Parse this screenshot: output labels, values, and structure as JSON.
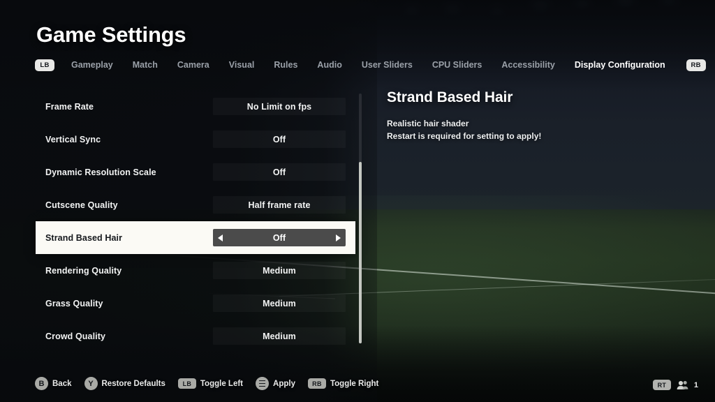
{
  "header": {
    "title": "Game Settings",
    "left_bumper": "LB",
    "right_bumper": "RB",
    "tabs": [
      {
        "label": "Gameplay",
        "active": false
      },
      {
        "label": "Match",
        "active": false
      },
      {
        "label": "Camera",
        "active": false
      },
      {
        "label": "Visual",
        "active": false
      },
      {
        "label": "Rules",
        "active": false
      },
      {
        "label": "Audio",
        "active": false
      },
      {
        "label": "User Sliders",
        "active": false
      },
      {
        "label": "CPU Sliders",
        "active": false
      },
      {
        "label": "Accessibility",
        "active": false
      },
      {
        "label": "Display Configuration",
        "active": true
      }
    ]
  },
  "settings": {
    "rows": [
      {
        "label": "Frame Rate",
        "value": "No Limit on fps",
        "selected": false
      },
      {
        "label": "Vertical Sync",
        "value": "Off",
        "selected": false
      },
      {
        "label": "Dynamic Resolution Scale",
        "value": "Off",
        "selected": false
      },
      {
        "label": "Cutscene Quality",
        "value": "Half frame rate",
        "selected": false
      },
      {
        "label": "Strand Based Hair",
        "value": "Off",
        "selected": true
      },
      {
        "label": "Rendering Quality",
        "value": "Medium",
        "selected": false
      },
      {
        "label": "Grass Quality",
        "value": "Medium",
        "selected": false
      },
      {
        "label": "Crowd Quality",
        "value": "Medium",
        "selected": false
      }
    ]
  },
  "detail": {
    "title": "Strand Based Hair",
    "line1": "Realistic hair shader",
    "line2": "Restart is required for setting to apply!"
  },
  "hints": [
    {
      "glyph": "B",
      "glyph_type": "circle",
      "label": "Back"
    },
    {
      "glyph": "Y",
      "glyph_type": "circle",
      "label": "Restore Defaults"
    },
    {
      "glyph": "LB",
      "glyph_type": "pill",
      "label": "Toggle Left"
    },
    {
      "glyph": "menu-icon",
      "glyph_type": "menu",
      "label": "Apply"
    },
    {
      "glyph": "RB",
      "glyph_type": "pill",
      "label": "Toggle Right"
    }
  ],
  "status": {
    "trigger": "RT",
    "players_icon": "people-icon",
    "count": "1"
  },
  "colors": {
    "selected_row_bg": "#fbfaf5",
    "selected_value_pill": "#4b4b4b",
    "accent_text": "#ffffff",
    "muted_text": "#9aa0a8",
    "glyph_badge": "#a9aaa6"
  }
}
